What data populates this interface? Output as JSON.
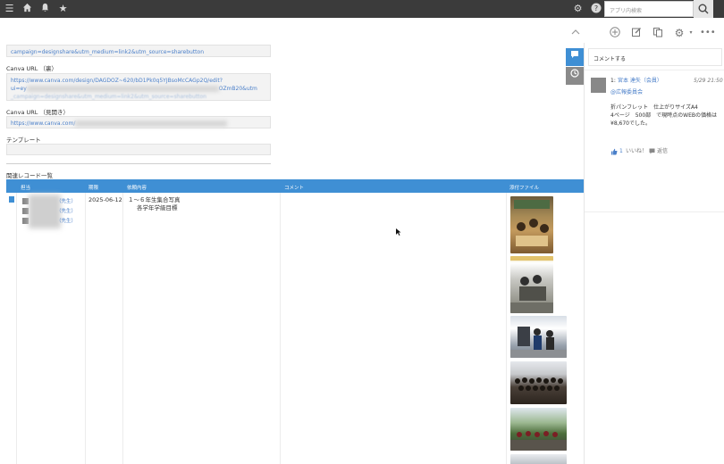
{
  "header": {
    "search_placeholder": "アプリ内検索"
  },
  "record": {
    "url_top_text": "campaign=designshare&utm_medium=link2&utm_source=sharebutton",
    "canva_url_view_label": "Canva URL （裏）",
    "canva_url_view_line1": "https://www.canva.com/design/DAGDOZ~620/bD1Pk0q5YJBsoMcCAGp2Q/edit?",
    "canva_url_view_line2_start": "ui=ey",
    "canva_url_view_line2_end": "OZmB20&utm",
    "canva_url_view_line3": "_campaign=designshare&utm_medium=link2&utm_source=sharebutton",
    "canva_url_open_label": "Canva URL （見開き）",
    "canva_url_open_value": "https://www.canva.com/",
    "template_label": "テンプレート",
    "related_label": "関連レコード一覧"
  },
  "table": {
    "headers": {
      "assignee": "担当",
      "deadline": "期限",
      "request": "依頼内容",
      "comment": "コメント",
      "attachment": "添付ファイル"
    },
    "row": {
      "assignee_1": "（先生）",
      "assignee_2": "（先生）",
      "assignee_3": "（先生）",
      "deadline": "2025-06-12",
      "request_line1": "１～６年生集合写真",
      "request_line2": "各学年学級目標"
    }
  },
  "comments": {
    "input_placeholder": "コメントする",
    "item": {
      "number": "1:",
      "author": "宮本 達矢（会員）",
      "timestamp": "5/29 21:50",
      "mention": "@広報委員会",
      "body_line1": "折パンフレット　仕上がりサイズA4",
      "body_line2": "4ページ　500部　で現時点のWEBの価格は",
      "body_line3": "¥8,670でした。",
      "like_count": "1",
      "like_label": "いいね！",
      "reply_label": "返信"
    }
  },
  "colors": {
    "header_bg": "#3b3b3b",
    "accent_blue": "#3f8fd4",
    "link_blue": "#4a7fc9",
    "side_tab_comment": "#3f8fd4",
    "side_tab_history": "#8a8a8a"
  }
}
